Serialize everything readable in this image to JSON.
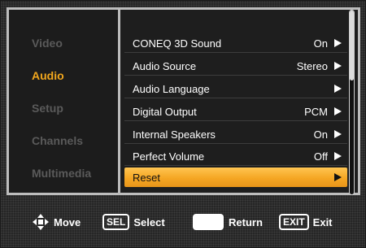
{
  "sidebar": {
    "items": [
      {
        "label": "Video",
        "active": false
      },
      {
        "label": "Audio",
        "active": true
      },
      {
        "label": "Setup",
        "active": false
      },
      {
        "label": "Channels",
        "active": false
      },
      {
        "label": "Multimedia",
        "active": false
      }
    ]
  },
  "menu": {
    "rows": [
      {
        "label": "CONEQ 3D Sound",
        "value": "On"
      },
      {
        "label": "Audio Source",
        "value": "Stereo"
      },
      {
        "label": "Audio Language",
        "value": ""
      },
      {
        "label": "Digital Output",
        "value": "PCM"
      },
      {
        "label": "Internal Speakers",
        "value": "On"
      },
      {
        "label": "Perfect Volume",
        "value": "Off"
      },
      {
        "label": "Reset",
        "value": "",
        "selected": true
      }
    ],
    "scroll_position": 0.0
  },
  "footer": {
    "move_label": "Move",
    "sel_key": "SEL",
    "select_label": "Select",
    "return_label": "Return",
    "exit_key": "EXIT",
    "exit_label": "Exit"
  },
  "colors": {
    "accent": "#f2a71d",
    "selected_row": "#f5a623",
    "inactive_text": "#5a5a5a"
  },
  "icons": {
    "move": "dpad-icon",
    "return": "return-key-icon",
    "row_arrow": "right-triangle-icon"
  }
}
